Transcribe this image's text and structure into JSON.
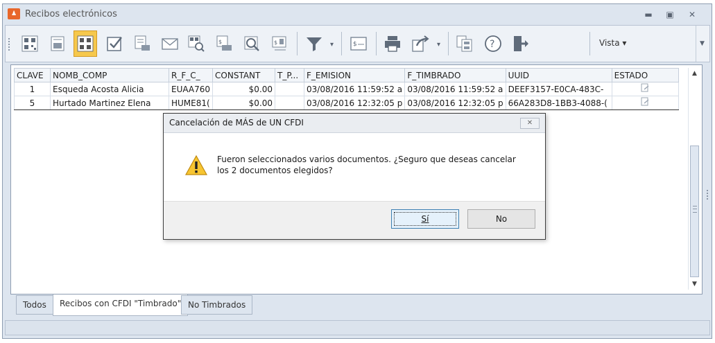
{
  "window": {
    "title": "Recibos electrónicos",
    "app_icon": "app-logo-icon",
    "controls": [
      "minimize-icon",
      "restore-icon",
      "close-icon"
    ]
  },
  "toolbar": {
    "buttons": [
      {
        "icon": "qr-code-icon"
      },
      {
        "icon": "receipt-icon"
      },
      {
        "icon": "qr-stamp-icon",
        "active": true
      },
      {
        "icon": "checkbox-icon"
      },
      {
        "icon": "document-print-icon"
      },
      {
        "icon": "envelope-icon"
      },
      {
        "icon": "qr-search-icon"
      },
      {
        "icon": "receipt-print-icon"
      },
      {
        "icon": "magnifier-icon"
      },
      {
        "icon": "receipt-stack-icon"
      },
      {
        "icon": "filter-icon"
      },
      {
        "icon": "invoice-icon"
      },
      {
        "icon": "printer-icon"
      },
      {
        "icon": "export-icon"
      },
      {
        "icon": "calculator-icon"
      },
      {
        "icon": "help-icon"
      },
      {
        "icon": "exit-icon"
      }
    ],
    "vista_label": "Vista"
  },
  "grid": {
    "columns": [
      "CLAVE",
      "NOMB_COMP",
      "R_F_C_",
      "CONSTANT",
      "T_P...",
      "F_EMISION",
      "F_TIMBRADO",
      "UUID",
      "ESTADO"
    ],
    "rows": [
      {
        "clave": "1",
        "nomb_comp": "Esqueda Acosta Alicia",
        "rfc": "EUAA760",
        "constant": "$0.00",
        "tp": "",
        "f_emision": "03/08/2016 11:59:52 a",
        "f_timbrado": "03/08/2016 11:59:52 a",
        "uuid": "DEEF3157-E0CA-483C-",
        "estado_icon": "stamped-document-icon"
      },
      {
        "clave": "5",
        "nomb_comp": "Hurtado Martinez Elena",
        "rfc": "HUME81(",
        "constant": "$0.00",
        "tp": "",
        "f_emision": "03/08/2016 12:32:05 p",
        "f_timbrado": "03/08/2016 12:32:05 p",
        "uuid": "66A283D8-1BB3-4088-(",
        "estado_icon": "stamped-document-icon"
      }
    ]
  },
  "tabs": [
    {
      "label": "Todos"
    },
    {
      "label": "Recibos con CFDI \"Timbrado\"",
      "active": true
    },
    {
      "label": "No Timbrados"
    }
  ],
  "dialog": {
    "title": "Cancelación de MÁS de UN CFDI",
    "message_line1": "Fueron seleccionados varios documentos. ¿Seguro que deseas cancelar",
    "message_line2": "los 2 documentos elegidos?",
    "yes_label": "Sí",
    "no_label": "No",
    "icon": "warning-icon"
  },
  "colors": {
    "window_bg": "#dde5ef",
    "active_tool": "#f6c84c",
    "app_icon": "#e8672b",
    "warning_yellow": "#f7c531"
  }
}
